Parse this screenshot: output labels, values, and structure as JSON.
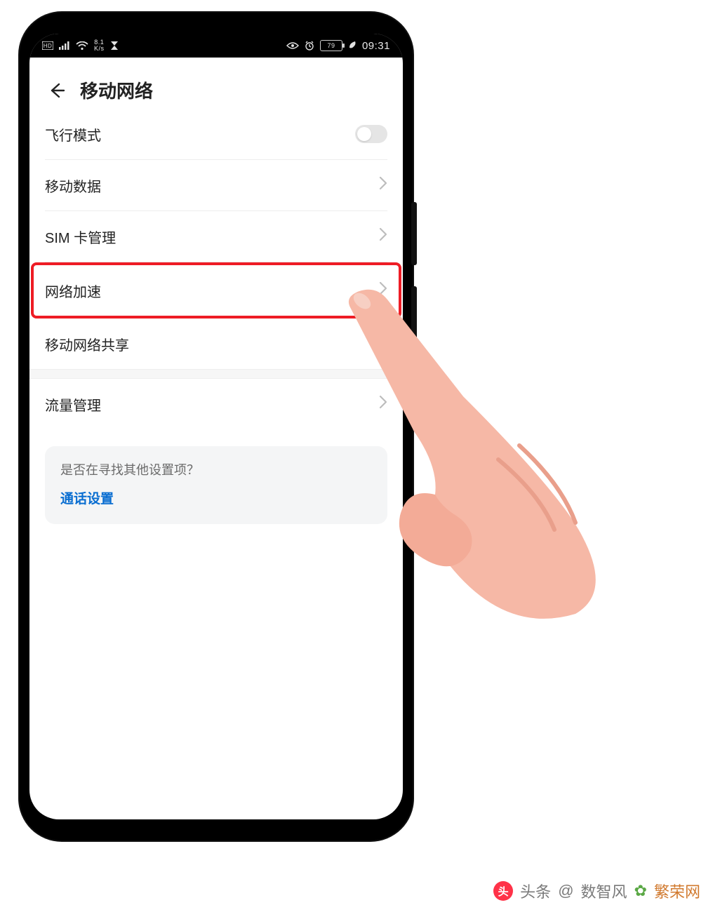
{
  "status_bar": {
    "net_rate": "8.1",
    "net_rate_unit": "K/s",
    "battery": "79",
    "time": "09:31"
  },
  "header": {
    "title": "移动网络"
  },
  "rows": {
    "airplane": {
      "label": "飞行模式"
    },
    "mobile_data": {
      "label": "移动数据"
    },
    "sim": {
      "label": "SIM 卡管理"
    },
    "accel": {
      "label": "网络加速"
    },
    "tether": {
      "label": "移动网络共享"
    },
    "traffic": {
      "label": "流量管理"
    }
  },
  "hint": {
    "title": "是否在寻找其他设置项？",
    "link": "通话设置"
  },
  "credit": {
    "prefix": "头条",
    "at": "@",
    "author": "数智风",
    "brand": "繁荣网"
  }
}
